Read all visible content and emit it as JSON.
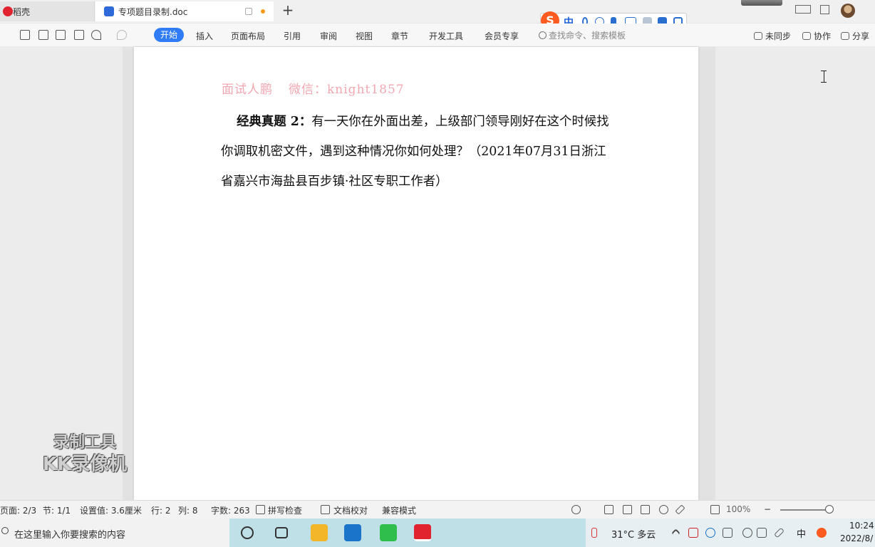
{
  "tabs": {
    "home_label": "稻壳",
    "doc_label": "专项题目录制.doc"
  },
  "ribbon": {
    "menus": [
      "开始",
      "插入",
      "页面布局",
      "引用",
      "审阅",
      "视图",
      "章节",
      "开发工具",
      "会员专享"
    ],
    "search_placeholder": "查找命令、搜索模板",
    "unsynced": "未同步",
    "collab": "协作",
    "share": "分享"
  },
  "ime": {
    "logo": "S",
    "mode": "中"
  },
  "document": {
    "watermark_title": "面试人鹏",
    "watermark_wechat": "微信：knight1857",
    "lead": "经典真题 2：",
    "para": "有一天你在外面出差，上级部门领导刚好在这个时候找你调取机密文件，遇到这种情况你如何处理？（2021年07月31日浙江省嘉兴市海盐县百步镇·社区专职工作者）"
  },
  "overlay": {
    "line1": "录制工具",
    "line2": "KK录像机"
  },
  "status": {
    "page": "页面: 2/3",
    "section": "节: 1/1",
    "setting": "设置值: 3.6厘米",
    "row": "行: 2",
    "col": "列: 8",
    "words": "字数: 263",
    "spell": "拼写检查",
    "proof": "文档校对",
    "compat": "兼容模式",
    "zoom": "100%"
  },
  "taskbar": {
    "search_placeholder": "在这里输入你要搜索的内容",
    "weather": "31°C 多云",
    "lang": "中",
    "time": "10:24",
    "date": "2022/8/"
  },
  "colors": {
    "accent": "#2f7cf6",
    "watermark": "#f2a7b1",
    "wps_red": "#e0232f"
  }
}
